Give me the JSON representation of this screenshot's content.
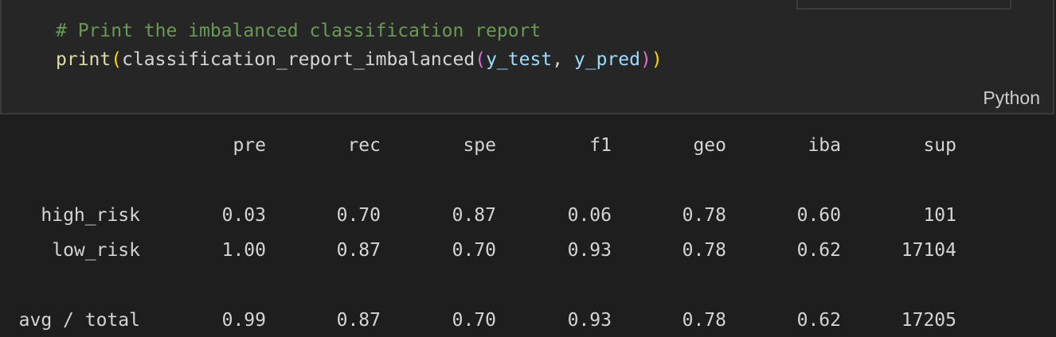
{
  "code": {
    "comment": "# Print the imbalanced classification report",
    "func": "print",
    "open1": "(",
    "inner_func": "classification_report_imbalanced",
    "open2": "(",
    "arg1": "y_test",
    "sep": ", ",
    "arg2": "y_pred",
    "close2": ")",
    "close1": ")",
    "language": "Python"
  },
  "report": {
    "headers": [
      "pre",
      "rec",
      "spe",
      "f1",
      "geo",
      "iba",
      "sup"
    ],
    "rows": [
      {
        "label": "high_risk",
        "values": [
          "0.03",
          "0.70",
          "0.87",
          "0.06",
          "0.78",
          "0.60",
          "101"
        ]
      },
      {
        "label": "low_risk",
        "values": [
          "1.00",
          "0.87",
          "0.70",
          "0.93",
          "0.78",
          "0.62",
          "17104"
        ]
      },
      {
        "label": "avg / total",
        "values": [
          "0.99",
          "0.87",
          "0.70",
          "0.93",
          "0.78",
          "0.62",
          "17205"
        ]
      }
    ]
  }
}
